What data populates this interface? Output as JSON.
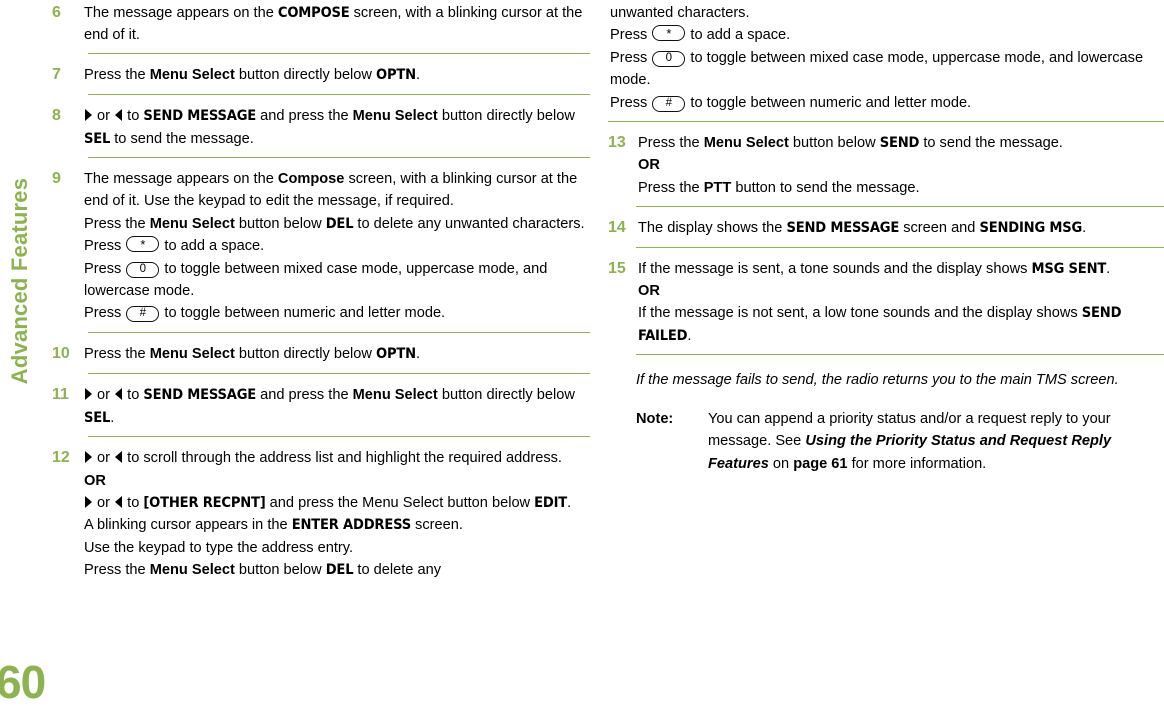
{
  "sidebar": {
    "chapter_label": "Advanced Features",
    "page_number": "60",
    "accent_color": "#8cb34f"
  },
  "left_column": {
    "steps": [
      {
        "number": "6",
        "lines": [
          "The message appears on the COMPOSE screen, with a blinking cursor at the end of it."
        ]
      },
      {
        "number": "7",
        "lines": [
          "Press the Menu Select button directly below OPTN."
        ]
      },
      {
        "number": "8",
        "lines": [
          "▶ or ◀ to SEND MESSAGE and press the Menu Select button directly below SEL to send the message."
        ]
      },
      {
        "number": "9",
        "lines": [
          "The message appears on the Compose screen, with a blinking cursor at the end of it. Use the keypad to edit the message, if required.",
          "Press the Menu Select button below DEL to delete any unwanted characters.",
          "Press (*) to add a space.",
          "Press (0) to toggle between mixed case mode, uppercase mode, and lowercase mode.",
          "Press (#) to toggle between numeric and letter mode."
        ]
      },
      {
        "number": "10",
        "lines": [
          "Press the Menu Select button directly below OPTN."
        ]
      },
      {
        "number": "11",
        "lines": [
          "▶ or ◀ to SEND MESSAGE and press the Menu Select button directly below SEL."
        ]
      },
      {
        "number": "12",
        "lines": [
          "▶ or ◀ to scroll through the address list and highlight the required address.",
          "OR",
          "▶ or ◀ to [OTHER RECPNT] and press the Menu Select button below EDIT.",
          "A blinking cursor appears in the ENTER ADDRESS screen.",
          "Use the keypad to type the address entry.",
          "Press the Menu Select button below DEL to delete any"
        ]
      }
    ]
  },
  "right_column": {
    "continuation": {
      "lines": [
        "unwanted characters.",
        "Press (*) to add a space.",
        "Press (0) to toggle between mixed case mode, uppercase mode, and lowercase mode.",
        "Press (#) to toggle between numeric and letter mode."
      ]
    },
    "steps": [
      {
        "number": "13",
        "lines": [
          "Press the Menu Select button below SEND to send the message.",
          "OR",
          "Press the PTT button to send the message."
        ]
      },
      {
        "number": "14",
        "lines": [
          "The display shows the SEND MESSAGE screen and SENDING MSG."
        ]
      },
      {
        "number": "15",
        "lines": [
          "If the message is sent, a tone sounds and the display shows MSG SENT.",
          "OR",
          "If the message is not sent, a low tone sounds and the display shows SEND FAILED."
        ]
      }
    ],
    "italic_note": "If the message fails to send, the radio returns you to the main TMS screen.",
    "note": {
      "label": "Note:",
      "text_part1": "You can append a priority status and/or a request reply to your message. See ",
      "reference_title": "Using the Priority Status and Request Reply Features",
      "text_part2": " on ",
      "page_reference": "page 61",
      "text_part3": " for more information."
    }
  },
  "inline_terms": {
    "compose_upper": "COMPOSE",
    "compose_mixed": "Compose",
    "menu_select": "Menu Select",
    "optn": "OPTN",
    "send_message": "SEND MESSAGE",
    "sel": "SEL",
    "del": "DEL",
    "edit": "EDIT",
    "send": "SEND",
    "ptt": "PTT",
    "sending_msg": "SENDING MSG",
    "msg_sent": "MSG SENT",
    "send_failed": "SEND FAILED",
    "other_recpnt": "[OTHER RECPNT]",
    "enter_address": "ENTER ADDRESS",
    "or": "OR",
    "key_star": "*",
    "key_zero": "0",
    "key_hash": "#"
  }
}
